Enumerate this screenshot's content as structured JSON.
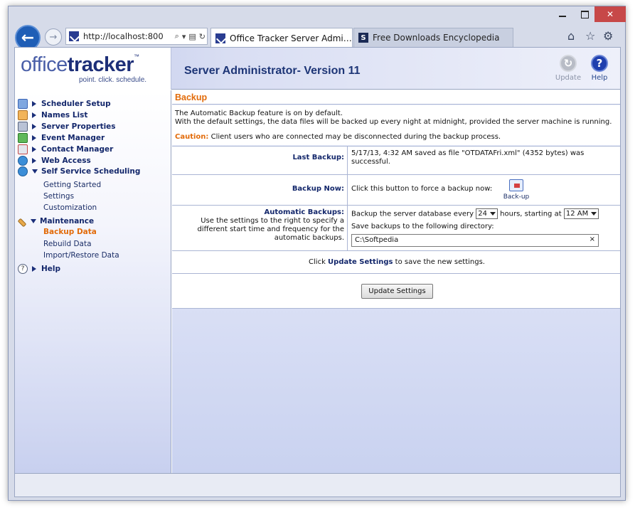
{
  "browser": {
    "address_url": "http://localhost:800",
    "tabs": [
      {
        "label": "Office Tracker Server Admi…"
      },
      {
        "label": "Free Downloads Encyclopedia"
      }
    ]
  },
  "header": {
    "logo_office": "office",
    "logo_tracker": "tracker",
    "logo_tm": "™",
    "logo_tagline": "point. click. schedule.",
    "title": "Server Administrator- Version 11",
    "update_label": "Update",
    "help_label": "Help"
  },
  "sidebar": {
    "items": [
      {
        "label": "Scheduler Setup"
      },
      {
        "label": "Names List"
      },
      {
        "label": "Server Properties"
      },
      {
        "label": "Event Manager"
      },
      {
        "label": "Contact Manager"
      },
      {
        "label": "Web Access"
      },
      {
        "label": "Self Service Scheduling"
      }
    ],
    "self_service_sub": [
      "Getting Started",
      "Settings",
      "Customization"
    ],
    "maintenance_label": "Maintenance",
    "maintenance_sub": [
      "Backup Data",
      "Rebuild Data",
      "Import/Restore Data"
    ],
    "help_label": "Help"
  },
  "content": {
    "section_title": "Backup",
    "intro_line1": "The Automatic Backup feature is on by default.",
    "intro_line2": "With the default settings, the data files will be backed up every night at midnight, provided the server machine is running.",
    "caution_label": "Caution:",
    "caution_text": " Client users who are connected may be disconnected during the backup process.",
    "last_backup_label": "Last Backup:",
    "last_backup_value": "5/17/13, 4:32 AM saved as file \"OTDATAFri.xml\" (4352 bytes) was successful.",
    "backup_now_label": "Backup Now:",
    "backup_now_text": "Click this button to force a backup now:",
    "backup_icon_label": "Back-up",
    "auto_label": "Automatic Backups:",
    "auto_desc": "Use the settings to the right to specify a different start time and frequency for the automatic backups.",
    "auto_text_1": "Backup the server database every",
    "hours_value": "24",
    "auto_text_2": "hours, starting at",
    "start_value": "12 AM",
    "dir_text": "Save backups to the following directory:",
    "dir_value": "C:\\Softpedia",
    "clear_x": "×",
    "info_prefix": "Click ",
    "info_bold": "Update Settings",
    "info_suffix": " to save the new settings.",
    "update_button": "Update Settings"
  }
}
